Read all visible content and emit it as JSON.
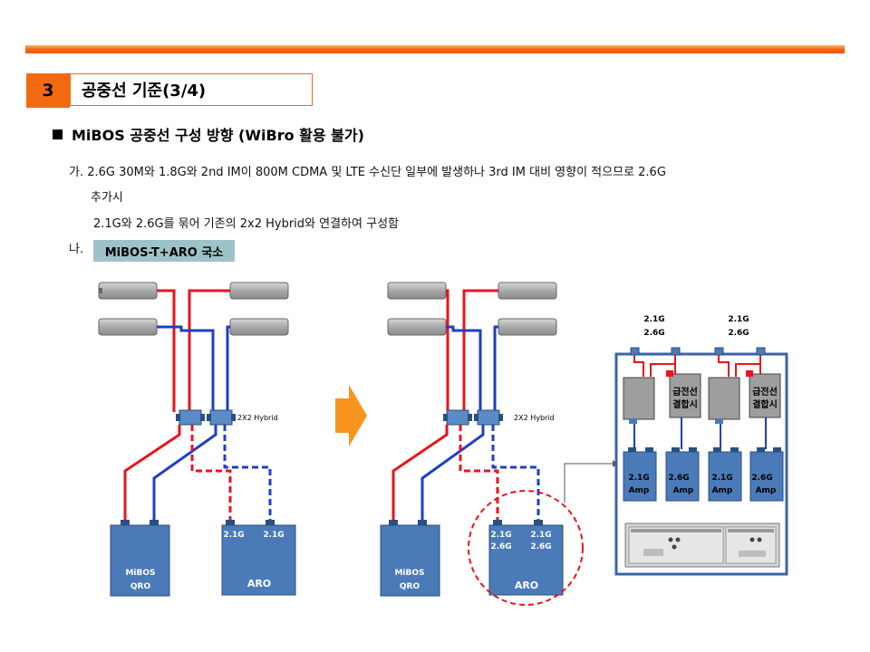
{
  "section": {
    "number": "3",
    "title": "공중선 기준(3/4)"
  },
  "subheading": "MiBOS 공중선 구성 방향 (WiBro 활용 불가)",
  "paragraph": {
    "line1": "가. 2.6G 30M와 1.8G와 2nd IM이 800M CDMA 및 LTE 수신단 일부에 발생하나 3rd IM 대비 영향이 적으므로 2.6G",
    "line2": "추가시",
    "line3": "2.1G와 2.6G를 묶어 기존의 2x2 Hybrid와 연결하여 구성함"
  },
  "item_na": {
    "prefix": "나.",
    "tag": "MiBOS-T+ARO 국소"
  },
  "diagram": {
    "hybrid_label": "2X2 Hybrid",
    "left": {
      "qro_line1": "MiBOS",
      "qro_line2": "QRO",
      "aro_label": "ARO",
      "aro_port1": "2.1G",
      "aro_port2": "2.1G"
    },
    "right": {
      "qro_line1": "MiBOS",
      "qro_line2": "QRO",
      "aro_label": "ARO",
      "aro_port1_a": "2.1G",
      "aro_port1_b": "2.6G",
      "aro_port2_a": "2.1G",
      "aro_port2_b": "2.6G"
    },
    "detail": {
      "top1_a": "2.1G",
      "top1_b": "2.6G",
      "top2_a": "2.1G",
      "top2_b": "2.6G",
      "combiner_line1": "급전선",
      "combiner_line2": "결합시",
      "amps": [
        {
          "freq": "2.1G",
          "word": "Amp"
        },
        {
          "freq": "2.6G",
          "word": "Amp"
        },
        {
          "freq": "2.1G",
          "word": "Amp"
        },
        {
          "freq": "2.6G",
          "word": "Amp"
        }
      ]
    }
  },
  "colors": {
    "accent_orange": "#f26a10",
    "feeder_red": "#e8141c",
    "feeder_blue": "#1c3fc4",
    "unit_blue": "#4a7ab8",
    "tag_teal": "#9dc3c9"
  }
}
